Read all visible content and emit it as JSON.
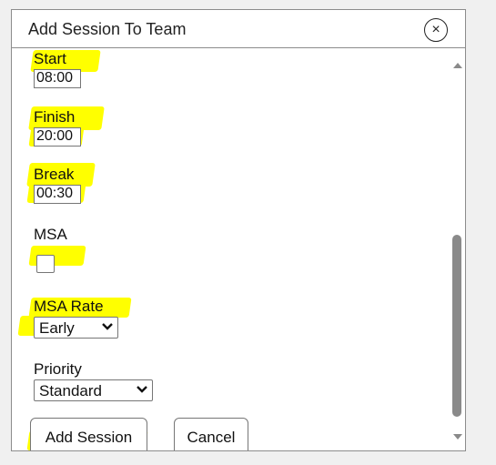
{
  "dialog": {
    "title": "Add Session To Team",
    "close_glyph": "×"
  },
  "form": {
    "start": {
      "label": "Start",
      "value": "08:00"
    },
    "finish": {
      "label": "Finish",
      "value": "20:00"
    },
    "break": {
      "label": "Break",
      "value": "00:30"
    },
    "msa": {
      "label": "MSA",
      "checked": false
    },
    "msa_rate": {
      "label": "MSA Rate",
      "selected": "Early"
    },
    "priority": {
      "label": "Priority",
      "selected": "Standard"
    }
  },
  "buttons": {
    "add_session": "Add Session",
    "cancel": "Cancel"
  },
  "highlight_color": "#ffff00"
}
